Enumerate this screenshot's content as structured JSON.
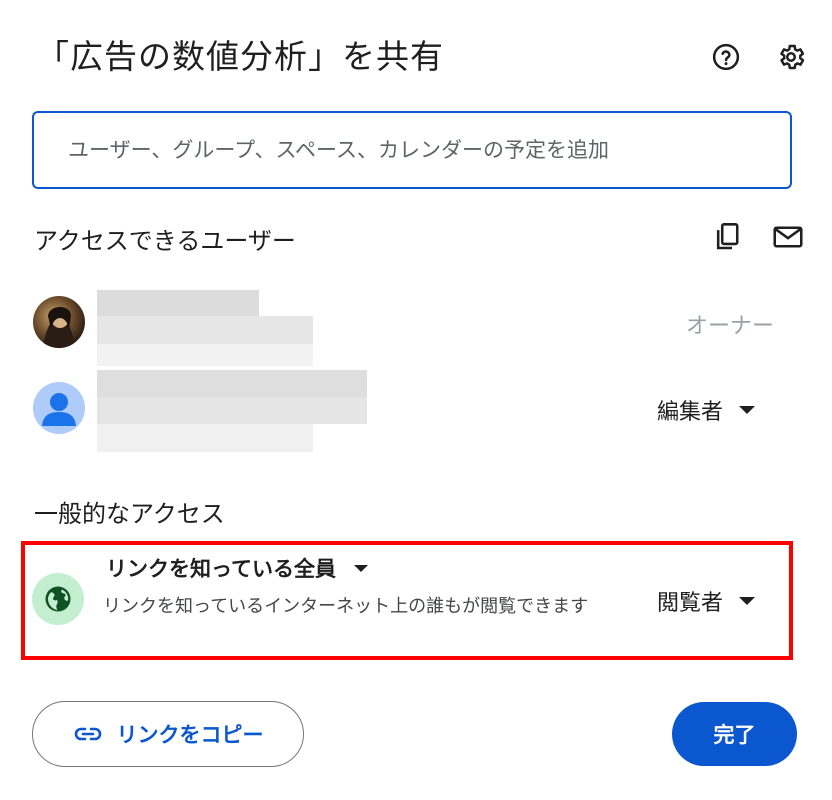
{
  "dialog": {
    "title": "「広告の数値分析」を共有",
    "help_icon": "help-circle-icon",
    "settings_icon": "gear-icon"
  },
  "search": {
    "placeholder": "ユーザー、グループ、スペース、カレンダーの予定を追加"
  },
  "people_section": {
    "title": "アクセスできるユーザー",
    "copy_icon": "copy-icon",
    "mail_icon": "mail-icon",
    "people": [
      {
        "role": "オーナー"
      },
      {
        "role": "編集者"
      }
    ]
  },
  "general_access": {
    "title": "一般的なアクセス",
    "scope": "リンクを知っている全員",
    "description": "リンクを知っているインターネット上の誰もが閲覧できます",
    "role": "閲覧者",
    "globe_icon": "globe-icon"
  },
  "footer": {
    "copy_link_label": "リンクをコピー",
    "done_label": "完了"
  },
  "colors": {
    "accent": "#0b57d0",
    "highlight": "#ff0000",
    "globe_bg": "#c4eed0"
  }
}
